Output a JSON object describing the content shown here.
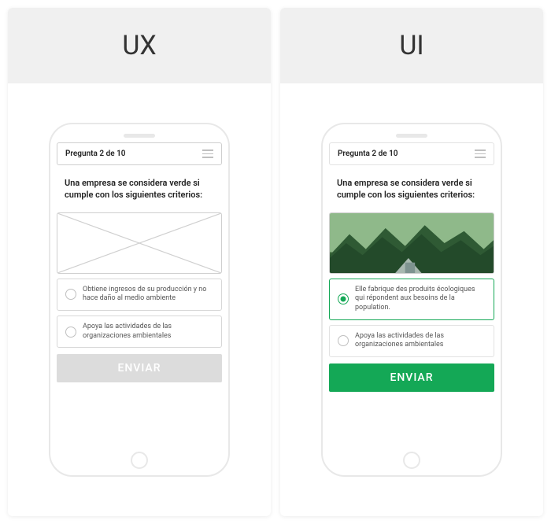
{
  "ux": {
    "title": "UX",
    "progress": "Pregunta 2 de 10",
    "question": "Una empresa se considera verde si cumple con los siguientes criterios:",
    "option1": "Obtiene ingresos de su producción y no hace daño al medio ambiente",
    "option2": "Apoya las actividades de las organizaciones ambientales",
    "submit": "ENVIAR"
  },
  "ui": {
    "title": "UI",
    "progress": "Pregunta 2 de 10",
    "question": "Una empresa se considera verde si cumple con los siguientes criterios:",
    "option1": "Elle fabrique des produits écologiques qui répondent aux besoins de la population.",
    "option2": "Apoya las actividades de las organizaciones ambientales",
    "submit": "ENVIAR",
    "accent": "#14a856"
  }
}
